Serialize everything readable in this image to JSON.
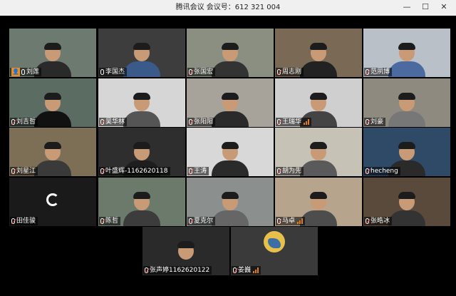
{
  "window": {
    "title": "腾讯会议  会议号：612 321 004",
    "minimize": "—",
    "maximize": "☐",
    "close": "✕"
  },
  "participants": [
    {
      "name": "刘莲",
      "mic": "on",
      "host": true,
      "active": true
    },
    {
      "name": "李国杰",
      "mic": "on"
    },
    {
      "name": "张国宏",
      "mic": "off"
    },
    {
      "name": "周志刚",
      "mic": "off"
    },
    {
      "name": "范夙博",
      "mic": "off"
    },
    {
      "name": "刘吉哲",
      "mic": "off"
    },
    {
      "name": "吴华林",
      "mic": "off"
    },
    {
      "name": "张阳阳",
      "mic": "off"
    },
    {
      "name": "王瑞华",
      "mic": "off",
      "signal": true
    },
    {
      "name": "刘豪",
      "mic": "off"
    },
    {
      "name": "刘星江",
      "mic": "off"
    },
    {
      "name": "叶盛辉-1162620118",
      "mic": "off"
    },
    {
      "name": "王涛",
      "mic": "off"
    },
    {
      "name": "胡为先",
      "mic": "off"
    },
    {
      "name": "hecheng",
      "mic": "off"
    },
    {
      "name": "田佳骏",
      "mic": "off",
      "loading": true
    },
    {
      "name": "陈哲",
      "mic": "off"
    },
    {
      "name": "夏克尔",
      "mic": "off"
    },
    {
      "name": "马卓",
      "mic": "off",
      "signal": true
    },
    {
      "name": "张晧冰",
      "mic": "off"
    },
    {
      "name": "张声婷1162620122",
      "mic": "off"
    },
    {
      "name": "姜巍",
      "mic": "off",
      "signal": true,
      "avatar": true
    }
  ],
  "colors": {
    "active_border": "#3bb25a",
    "host_badge": "#f08a24",
    "mic_muted": "#e24a4a",
    "signal": "#e07b28"
  }
}
